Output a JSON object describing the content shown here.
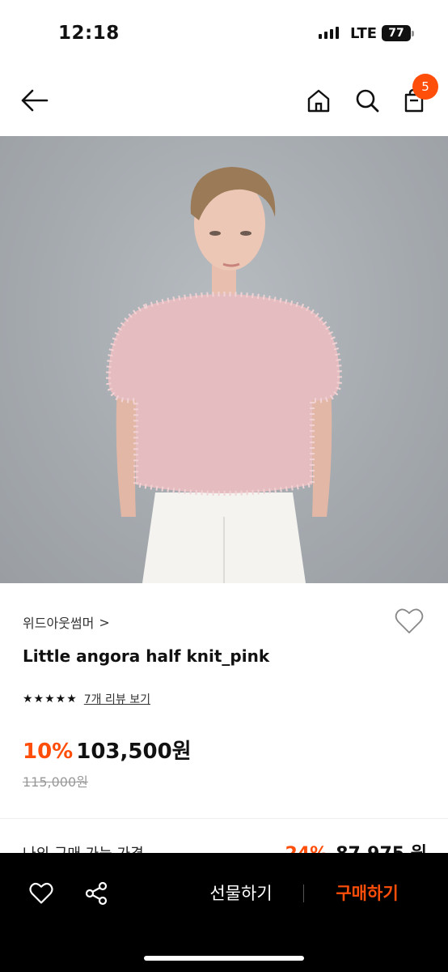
{
  "status_bar": {
    "time": "12:18",
    "network": "LTE",
    "battery": "77"
  },
  "header": {
    "back_icon": "arrow-left-icon",
    "home_icon": "home-icon",
    "search_icon": "search-icon",
    "cart_icon": "shopping-bag-icon",
    "cart_count": "5"
  },
  "product": {
    "image_icon": "product-photo",
    "brand": "위드아웃썸머",
    "brand_chevron": ">",
    "name": "Little angora half knit_pink",
    "rating": 5,
    "stars": "★★★★★",
    "review_link": "7개 리뷰 보기",
    "discount": "10%",
    "price": "103,500원",
    "original_price": "115,000원"
  },
  "my_price": {
    "label": "나의 구매 가능 가격",
    "discount": "24%",
    "price": "87,975 원"
  },
  "bottom_bar": {
    "gift_label": "선물하기",
    "buy_label": "구매하기"
  },
  "colors": {
    "accent": "#ff4e0a",
    "bottom_bar": "#000000",
    "text": "#111111"
  }
}
